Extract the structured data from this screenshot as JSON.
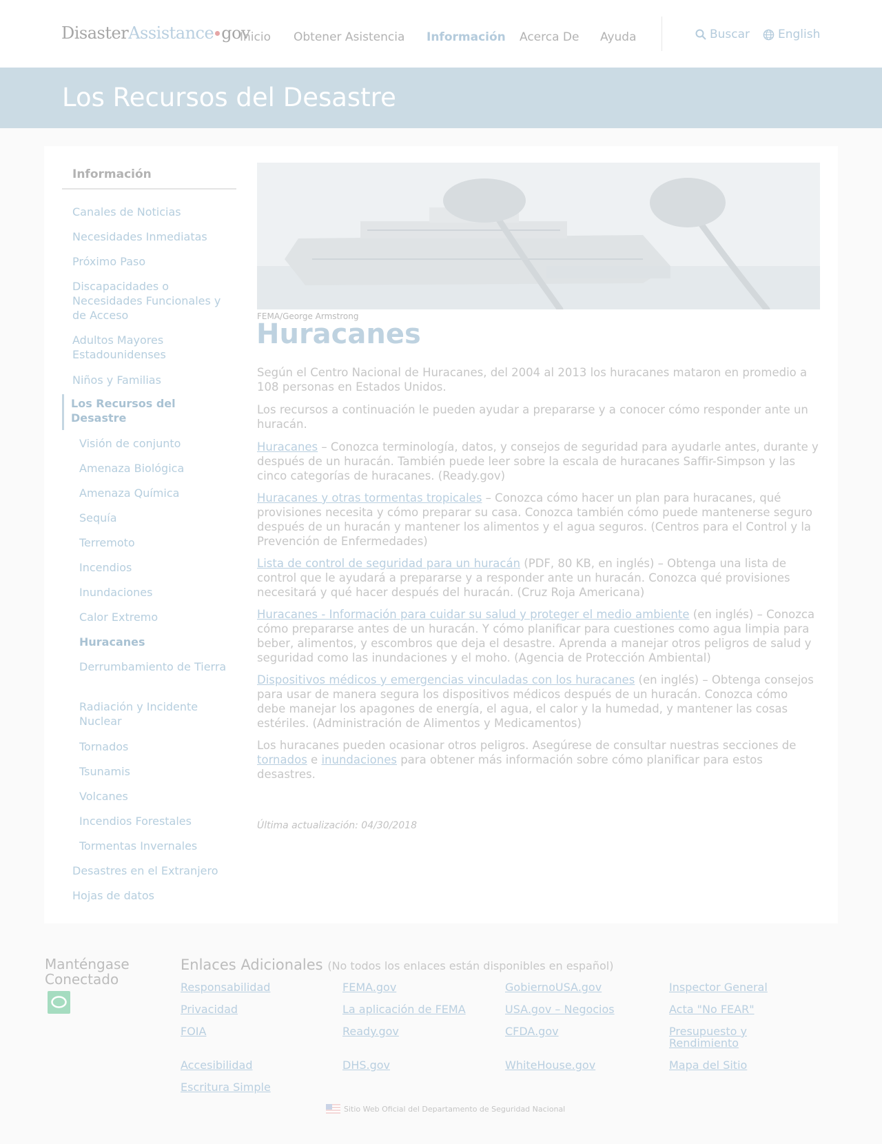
{
  "header": {
    "logo": {
      "part1": "Disaster",
      "part2": "Assistance",
      "part3": "gov"
    },
    "nav": [
      "Inicio",
      "Obtener Asistencia",
      "Información",
      "Acerca De",
      "Ayuda"
    ],
    "search_label": "Buscar",
    "language_label": "English"
  },
  "banner": {
    "title": "Los Recursos del Desastre"
  },
  "sidebar": {
    "heading": "Información",
    "items_top": [
      "Canales de Noticias",
      "Necesidades Inmediatas",
      "Próximo Paso",
      "Discapacidades o Necesidades Funcionales y de Acceso",
      "Adultos Mayores Estadounidenses",
      "Niños y Familias"
    ],
    "current_section": "Los Recursos del Desastre",
    "sub_items": [
      "Visión de conjunto",
      "Amenaza Biológica",
      "Amenaza Química",
      "Sequía",
      "Terremoto",
      "Incendios",
      "Inundaciones",
      "Calor Extremo",
      "Huracanes",
      "Derrumbamiento de Tierra",
      "Radiación y Incidente Nuclear",
      "Tornados",
      "Tsunamis",
      "Volcanes",
      "Incendios Forestales",
      "Tormentas Invernales"
    ],
    "items_bottom": [
      "Desastres en el Extranjero",
      "Hojas de datos"
    ]
  },
  "main": {
    "image_caption": "FEMA/George Armstrong",
    "title": "Huracanes",
    "p1": "Según el Centro Nacional de Huracanes, del 2004 al 2013 los huracanes mataron en promedio a 108 personas en Estados Unidos.",
    "p2": "Los recursos a continuación le pueden ayudar a prepararse y a conocer cómo responder ante un huracán.",
    "r1_link": "Huracanes",
    "r1_text": " – Conozca terminología, datos, y consejos de seguridad para ayudarle antes, durante y después de un huracán. También puede leer sobre la escala de huracanes Saffir-Simpson y las cinco categorías de huracanes. (Ready.gov)",
    "r2_link": "Huracanes y otras tormentas tropicales",
    "r2_text": " – Conozca cómo hacer un plan para huracanes, qué provisiones necesita y cómo preparar su casa. Conozca también cómo puede mantenerse seguro después de un huracán y mantener los alimentos y el agua seguros. (Centros para el Control y la Prevención de Enfermedades)",
    "r3_link": "Lista de control de seguridad para un huracán",
    "r3_text": " (PDF, 80 KB, en inglés) – Obtenga una lista de control que le ayudará a prepararse y a responder ante un huracán. Conozca qué provisiones necesitará y qué hacer después del huracán. (Cruz Roja Americana)",
    "r4_link": "Huracanes - Información para cuidar su salud y proteger el medio ambiente",
    "r4_text": " (en inglés) – Conozca cómo prepararse antes de un huracán. Y cómo planificar para cuestiones como agua limpia para beber, alimentos, y escombros que deja el desastre. Aprenda a manejar otros peligros de salud y seguridad como las inundaciones y el moho. (Agencia de Protección Ambiental)",
    "r5_link": "Dispositivos médicos y emergencias vinculadas con los huracanes",
    "r5_text": " (en inglés) – Obtenga consejos para usar de manera segura los dispositivos médicos después de un huracán. Conozca cómo debe manejar los apagones de energía, el agua, el calor y la humedad, y mantener las cosas estériles. (Administración de Alimentos y Medicamentos)",
    "p3_pre": "Los huracanes pueden ocasionar otros peligros. Asegúrese de consultar nuestras secciones de ",
    "p3_link1": "tornados",
    "p3_mid": " e ",
    "p3_link2": "inundaciones",
    "p3_post": " para obtener más información sobre cómo planificar para estos desastres.",
    "updated": "Última actualización: 04/30/2018"
  },
  "footer": {
    "stay_connected": "Manténgase Conectado",
    "links_heading": "Enlaces Adicionales",
    "links_note": "(No todos los enlaces están disponibles en español)",
    "links": [
      "Responsabilidad",
      "FEMA.gov",
      "GobiernoUSA.gov",
      "Inspector General",
      "Privacidad",
      "La aplicación de FEMA",
      "USA.gov – Negocios",
      "Acta \"No FEAR\"",
      "FOIA",
      "Ready.gov",
      "CFDA.gov",
      "Presupuesto y Rendimiento",
      "Accesibilidad",
      "DHS.gov",
      "WhiteHouse.gov",
      "Mapa del Sitio",
      "Escritura Simple"
    ],
    "official": "Sitio Web Oficial del Departamento de Seguridad Nacional"
  },
  "colors": {
    "link": "#b9cfe0",
    "banner": "#cbdbe4",
    "social": "#a5dcc0"
  }
}
